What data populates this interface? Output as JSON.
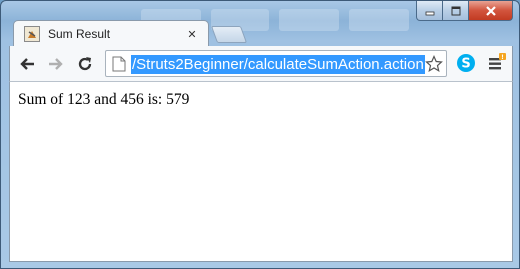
{
  "tab": {
    "title": "Sum Result",
    "close_glyph": "✕"
  },
  "toolbar": {
    "url": "/Struts2Beginner/calculateSumAction.action",
    "back_icon": "back-arrow-icon",
    "forward_icon": "forward-arrow-icon",
    "reload_icon": "reload-icon",
    "bookmark_icon": "star-icon",
    "extension_icon": "skype-icon",
    "menu_icon": "hamburger-menu-icon",
    "url_highlight_color": "#3399ff"
  },
  "page": {
    "result_text": "Sum of 123 and 456 is: 579"
  },
  "window": {
    "close_color": "#c23b22"
  }
}
